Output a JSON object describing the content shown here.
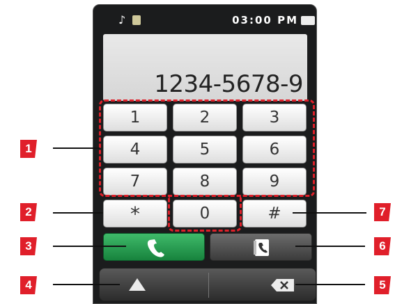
{
  "status": {
    "time": "03:00 PM"
  },
  "display": {
    "number": "1234-5678-9"
  },
  "keypad": {
    "keys": [
      "1",
      "2",
      "3",
      "4",
      "5",
      "6",
      "7",
      "8",
      "9",
      "*",
      "0",
      "#"
    ]
  },
  "callouts": [
    "1",
    "2",
    "3",
    "4",
    "5",
    "6",
    "7"
  ],
  "colors": {
    "accent": "#e01f2a",
    "call": "#17833d"
  }
}
